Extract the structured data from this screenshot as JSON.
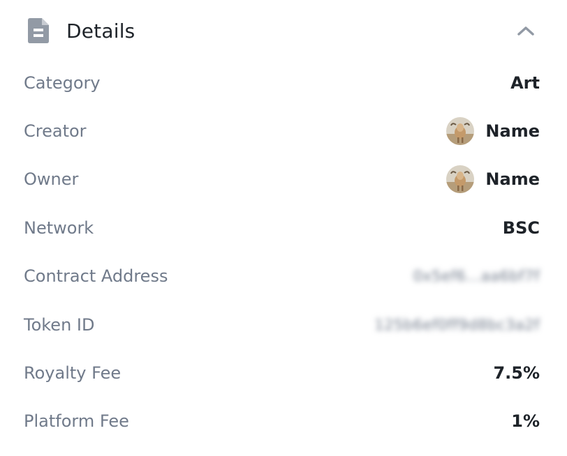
{
  "details": {
    "title": "Details",
    "icons": {
      "header": "document-icon",
      "toggle": "chevron-up-icon",
      "avatar": "goat-avatar"
    },
    "colors": {
      "label": "#707a8a",
      "value": "#1e2329",
      "icon": "#929aa5"
    },
    "rows": [
      {
        "label": "Category",
        "value": "Art"
      },
      {
        "label": "Creator",
        "value": "Name"
      },
      {
        "label": "Owner",
        "value": "Name"
      },
      {
        "label": "Network",
        "value": "BSC"
      },
      {
        "label": "Contract Address",
        "value": "0x5ef6...aa6bf7f"
      },
      {
        "label": "Token ID",
        "value": "125b6ef0ff9d8bc3a2f"
      },
      {
        "label": "Royalty Fee",
        "value": "7.5%"
      },
      {
        "label": "Platform Fee",
        "value": "1%"
      }
    ]
  }
}
